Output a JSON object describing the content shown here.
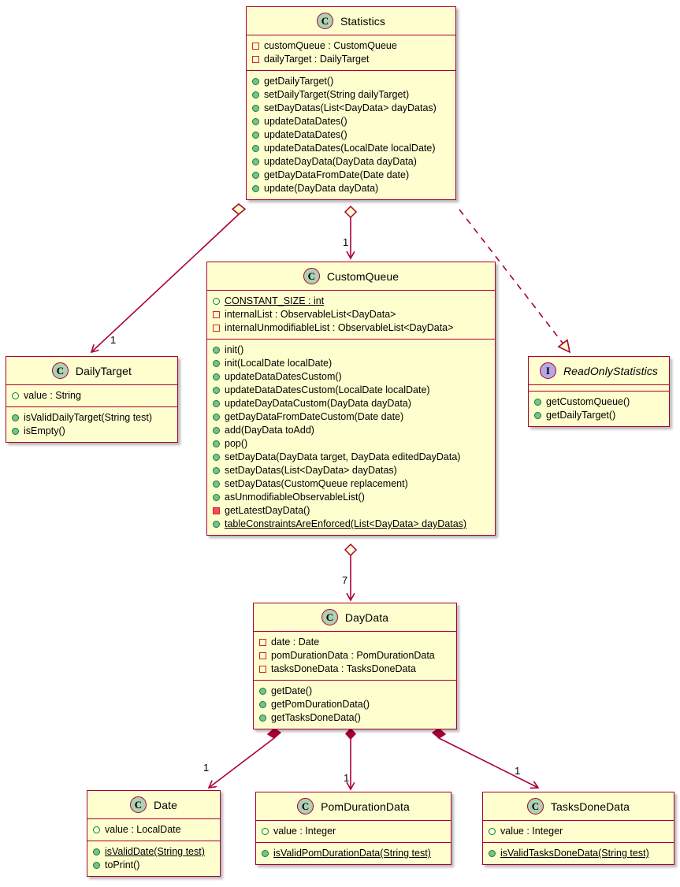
{
  "diagram": {
    "type": "uml-class-diagram",
    "background": "#FFFFFF",
    "colors": {
      "class_fill": "#FEFECE",
      "border": "#A80036",
      "line": "#A80036",
      "class_icon_fill": "#ADD1B2",
      "interface_icon_fill": "#B4A7E5",
      "public_method_marker": "#84BE84",
      "private_method_marker": "#F24D5C",
      "private_field_marker": "#C82930",
      "public_field_marker": "#038048"
    }
  },
  "classes": {
    "statistics": {
      "stereotype": "C",
      "name": "Statistics",
      "fields": [
        {
          "marker": "private-field",
          "text": "customQueue : CustomQueue",
          "static": false
        },
        {
          "marker": "private-field",
          "text": "dailyTarget : DailyTarget",
          "static": false
        }
      ],
      "methods": [
        {
          "marker": "public-method",
          "text": "getDailyTarget()",
          "static": false
        },
        {
          "marker": "public-method",
          "text": "setDailyTarget(String dailyTarget)",
          "static": false
        },
        {
          "marker": "public-method",
          "text": "setDayDatas(List<DayData> dayDatas)",
          "static": false
        },
        {
          "marker": "public-method",
          "text": "updateDataDates()",
          "static": false
        },
        {
          "marker": "public-method",
          "text": "updateDataDates()",
          "static": false
        },
        {
          "marker": "public-method",
          "text": "updateDataDates(LocalDate localDate)",
          "static": false
        },
        {
          "marker": "public-method",
          "text": "updateDayData(DayData dayData)",
          "static": false
        },
        {
          "marker": "public-method",
          "text": "getDayDataFromDate(Date date)",
          "static": false
        },
        {
          "marker": "public-method",
          "text": "update(DayData dayData)",
          "static": false
        }
      ]
    },
    "custom_queue": {
      "stereotype": "C",
      "name": "CustomQueue",
      "fields": [
        {
          "marker": "public-field",
          "text": "CONSTANT_SIZE : int",
          "static": true
        },
        {
          "marker": "private-field",
          "text": "internalList : ObservableList<DayData>",
          "static": false
        },
        {
          "marker": "private-field",
          "text": "internalUnmodifiableList : ObservableList<DayData>",
          "static": false
        }
      ],
      "methods": [
        {
          "marker": "public-method",
          "text": "init()",
          "static": false
        },
        {
          "marker": "public-method",
          "text": "init(LocalDate localDate)",
          "static": false
        },
        {
          "marker": "public-method",
          "text": "updateDataDatesCustom()",
          "static": false
        },
        {
          "marker": "public-method",
          "text": "updateDataDatesCustom(LocalDate localDate)",
          "static": false
        },
        {
          "marker": "public-method",
          "text": "updateDayDataCustom(DayData dayData)",
          "static": false
        },
        {
          "marker": "public-method",
          "text": "getDayDataFromDateCustom(Date date)",
          "static": false
        },
        {
          "marker": "public-method",
          "text": "add(DayData toAdd)",
          "static": false
        },
        {
          "marker": "public-method",
          "text": "pop()",
          "static": false
        },
        {
          "marker": "public-method",
          "text": "setDayData(DayData target, DayData editedDayData)",
          "static": false
        },
        {
          "marker": "public-method",
          "text": "setDayDatas(List<DayData> dayDatas)",
          "static": false
        },
        {
          "marker": "public-method",
          "text": "setDayDatas(CustomQueue replacement)",
          "static": false
        },
        {
          "marker": "public-method",
          "text": "asUnmodifiableObservableList()",
          "static": false
        },
        {
          "marker": "private-method",
          "text": "getLatestDayData()",
          "static": false
        },
        {
          "marker": "public-method",
          "text": "tableConstraintsAreEnforced(List<DayData> dayDatas)",
          "static": true
        }
      ]
    },
    "daily_target": {
      "stereotype": "C",
      "name": "DailyTarget",
      "fields": [
        {
          "marker": "public-field",
          "text": "value : String",
          "static": false
        }
      ],
      "methods": [
        {
          "marker": "public-method",
          "text": "isValidDailyTarget(String test)",
          "static": false
        },
        {
          "marker": "public-method",
          "text": "isEmpty()",
          "static": false
        }
      ]
    },
    "read_only_statistics": {
      "stereotype": "I",
      "name": "ReadOnlyStatistics",
      "italic": true,
      "fields": [],
      "methods": [
        {
          "marker": "public-method",
          "text": "getCustomQueue()",
          "static": false
        },
        {
          "marker": "public-method",
          "text": "getDailyTarget()",
          "static": false
        }
      ]
    },
    "day_data": {
      "stereotype": "C",
      "name": "DayData",
      "fields": [
        {
          "marker": "private-field",
          "text": "date : Date",
          "static": false
        },
        {
          "marker": "private-field",
          "text": "pomDurationData : PomDurationData",
          "static": false
        },
        {
          "marker": "private-field",
          "text": "tasksDoneData : TasksDoneData",
          "static": false
        }
      ],
      "methods": [
        {
          "marker": "public-method",
          "text": "getDate()",
          "static": false
        },
        {
          "marker": "public-method",
          "text": "getPomDurationData()",
          "static": false
        },
        {
          "marker": "public-method",
          "text": "getTasksDoneData()",
          "static": false
        }
      ]
    },
    "date": {
      "stereotype": "C",
      "name": "Date",
      "fields": [
        {
          "marker": "public-field",
          "text": "value : LocalDate",
          "static": false
        }
      ],
      "methods": [
        {
          "marker": "public-method",
          "text": "isValidDate(String test)",
          "static": true
        },
        {
          "marker": "public-method",
          "text": "toPrint()",
          "static": false
        }
      ]
    },
    "pom_duration_data": {
      "stereotype": "C",
      "name": "PomDurationData",
      "fields": [
        {
          "marker": "public-field",
          "text": "value : Integer",
          "static": false
        }
      ],
      "methods": [
        {
          "marker": "public-method",
          "text": "isValidPomDurationData(String test)",
          "static": true
        }
      ]
    },
    "tasks_done_data": {
      "stereotype": "C",
      "name": "TasksDoneData",
      "fields": [
        {
          "marker": "public-field",
          "text": "value : Integer",
          "static": false
        }
      ],
      "methods": [
        {
          "marker": "public-method",
          "text": "isValidTasksDoneData(String test)",
          "static": true
        }
      ]
    }
  },
  "relationships": [
    {
      "from": "Statistics",
      "to": "DailyTarget",
      "kind": "aggregation",
      "multiplicity": "1"
    },
    {
      "from": "Statistics",
      "to": "CustomQueue",
      "kind": "aggregation",
      "multiplicity": "1"
    },
    {
      "from": "Statistics",
      "to": "ReadOnlyStatistics",
      "kind": "realization",
      "multiplicity": ""
    },
    {
      "from": "CustomQueue",
      "to": "DayData",
      "kind": "aggregation",
      "multiplicity": "7"
    },
    {
      "from": "DayData",
      "to": "Date",
      "kind": "composition",
      "multiplicity": "1"
    },
    {
      "from": "DayData",
      "to": "PomDurationData",
      "kind": "composition",
      "multiplicity": "1"
    },
    {
      "from": "DayData",
      "to": "TasksDoneData",
      "kind": "composition",
      "multiplicity": "1"
    }
  ],
  "edge_labels": {
    "stats_to_dailytarget": "1",
    "stats_to_customqueue": "1",
    "customqueue_to_daydata": "7",
    "daydata_to_date": "1",
    "daydata_to_pom": "1",
    "daydata_to_tasks": "1"
  }
}
